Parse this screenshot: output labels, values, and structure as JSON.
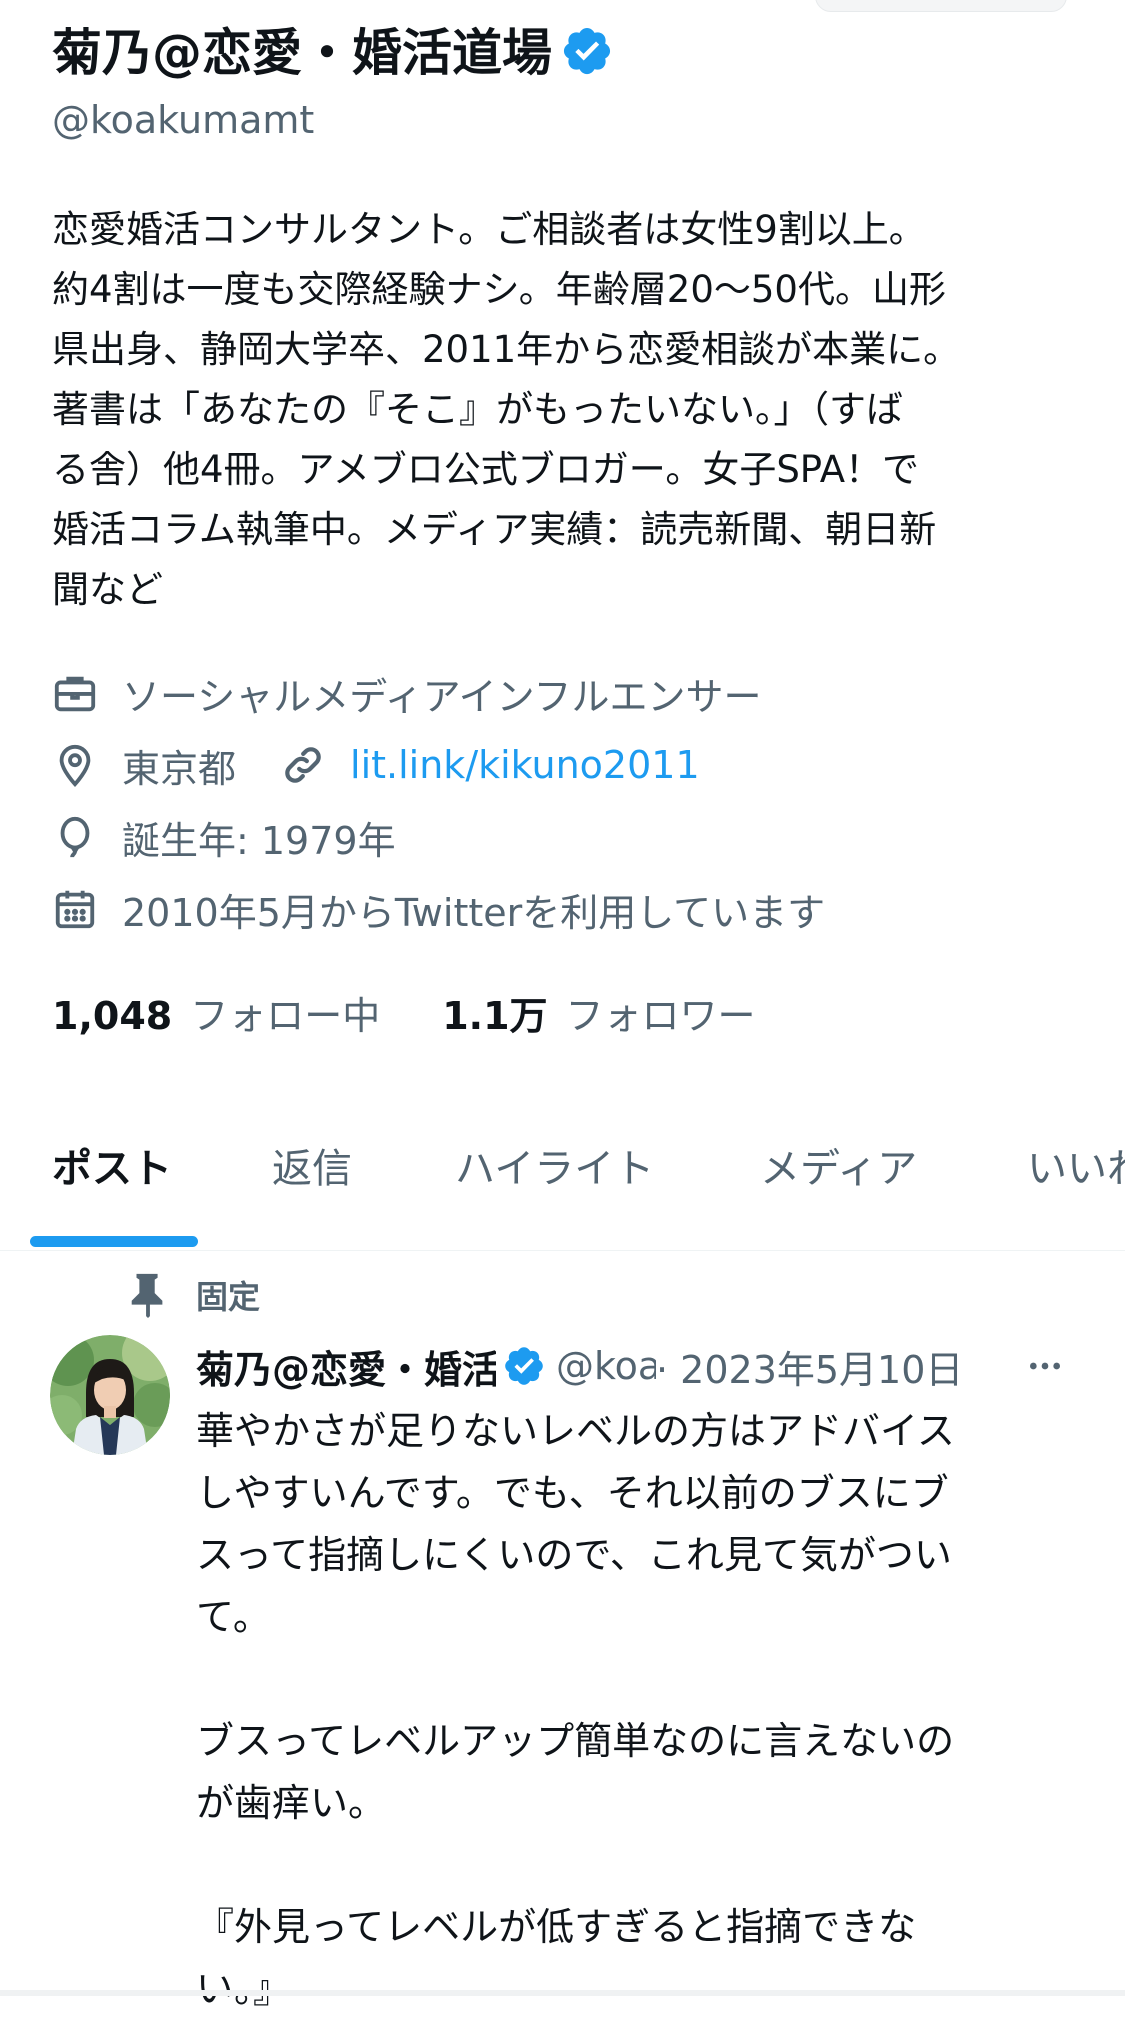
{
  "profile": {
    "display_name": "菊乃@恋愛・婚活道場",
    "handle": "@koakumamt",
    "bio_lines": [
      "恋愛婚活コンサルタント。ご相談者は女性9割以上。",
      "約4割は一度も交際経験ナシ。年齢層20〜50代。山形",
      "県出身、静岡大学卒、2011年から恋愛相談が本業に。",
      "著書は「あなたの『そこ』がもったいない。」（すば",
      "る舎）他4冊。アメブロ公式ブロガー。女子SPA！で",
      "婚活コラム執筆中。メディア実績：読売新聞、朝日新",
      "聞など"
    ],
    "category": "ソーシャルメディアインフルエンサー",
    "location": "東京都",
    "link": "lit.link/kikuno2011",
    "birth": "誕生年: 1979年",
    "joined": "2010年5月からTwitterを利用しています",
    "following_count": "1,048",
    "following_label": "フォロー中",
    "followers_count": "1.1万",
    "followers_label": "フォロワー",
    "verified_color": "#1d9bf0"
  },
  "tabs": [
    {
      "label": "ポスト",
      "active": true
    },
    {
      "label": "返信",
      "active": false
    },
    {
      "label": "ハイライト",
      "active": false
    },
    {
      "label": "メディア",
      "active": false
    },
    {
      "label": "いいね",
      "active": false
    }
  ],
  "pinned_post": {
    "pinned_label": "固定",
    "author_name": "菊乃@恋愛・婚活道場",
    "author_handle": "@koakumamt",
    "date": "· 2023年5月10日",
    "body_lines": [
      "華やかさが足りないレベルの方はアドバイス",
      "しやすいんです。でも、それ以前のブスにブ",
      "スって指摘しにくいので、これ見て気がつい",
      "て。",
      "",
      "ブスってレベルアップ簡単なのに言えないの",
      "が歯痒い。",
      "",
      "『外見ってレベルが低すぎると指摘できな",
      "い。』"
    ]
  }
}
